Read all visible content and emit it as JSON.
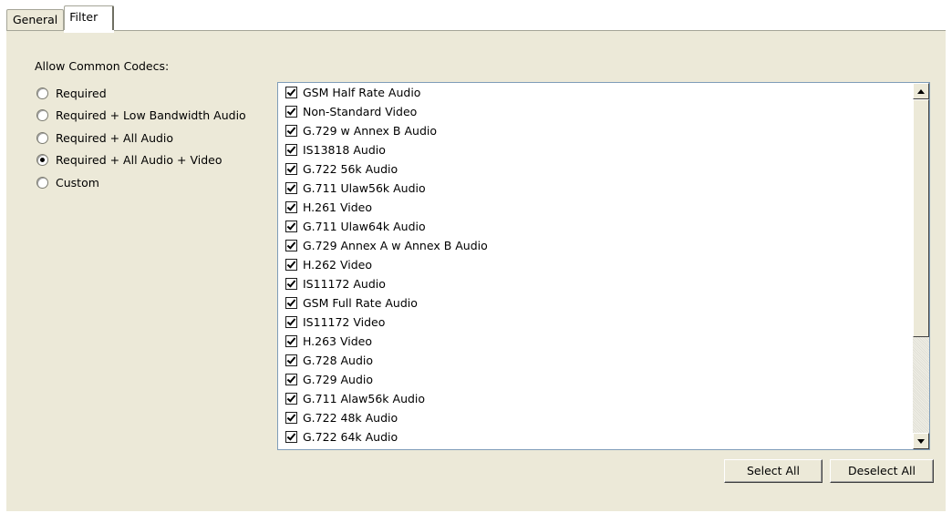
{
  "tabs": [
    {
      "label": "General",
      "active": false
    },
    {
      "label": "Filter",
      "active": true
    }
  ],
  "filter": {
    "group_label": "Allow Common Codecs:",
    "options": [
      {
        "label": "Required",
        "selected": false
      },
      {
        "label": "Required + Low Bandwidth Audio",
        "selected": false
      },
      {
        "label": "Required + All Audio",
        "selected": false
      },
      {
        "label": "Required + All Audio + Video",
        "selected": true
      },
      {
        "label": "Custom",
        "selected": false
      }
    ],
    "codecs": [
      {
        "label": "GSM Half Rate Audio",
        "checked": true
      },
      {
        "label": "Non-Standard Video",
        "checked": true
      },
      {
        "label": "G.729 w Annex B Audio",
        "checked": true
      },
      {
        "label": "IS13818 Audio",
        "checked": true
      },
      {
        "label": "G.722 56k Audio",
        "checked": true
      },
      {
        "label": "G.711 Ulaw56k Audio",
        "checked": true
      },
      {
        "label": "H.261 Video",
        "checked": true
      },
      {
        "label": "G.711 Ulaw64k Audio",
        "checked": true
      },
      {
        "label": "G.729 Annex A w Annex B Audio",
        "checked": true
      },
      {
        "label": "H.262 Video",
        "checked": true
      },
      {
        "label": "IS11172 Audio",
        "checked": true
      },
      {
        "label": "GSM Full Rate Audio",
        "checked": true
      },
      {
        "label": "IS11172 Video",
        "checked": true
      },
      {
        "label": "H.263 Video",
        "checked": true
      },
      {
        "label": "G.728 Audio",
        "checked": true
      },
      {
        "label": "G.729 Audio",
        "checked": true
      },
      {
        "label": "G.711 Alaw56k Audio",
        "checked": true
      },
      {
        "label": "G.722 48k Audio",
        "checked": true
      },
      {
        "label": "G.722 64k Audio",
        "checked": true
      }
    ],
    "scroll_position": 0,
    "select_all_label": "Select All",
    "deselect_all_label": "Deselect All"
  },
  "colors": {
    "panel_bg": "#ece9d8",
    "list_border": "#7f9db9"
  },
  "icons": {
    "scroll_up": "triangle-up-icon",
    "scroll_down": "triangle-down-icon"
  }
}
